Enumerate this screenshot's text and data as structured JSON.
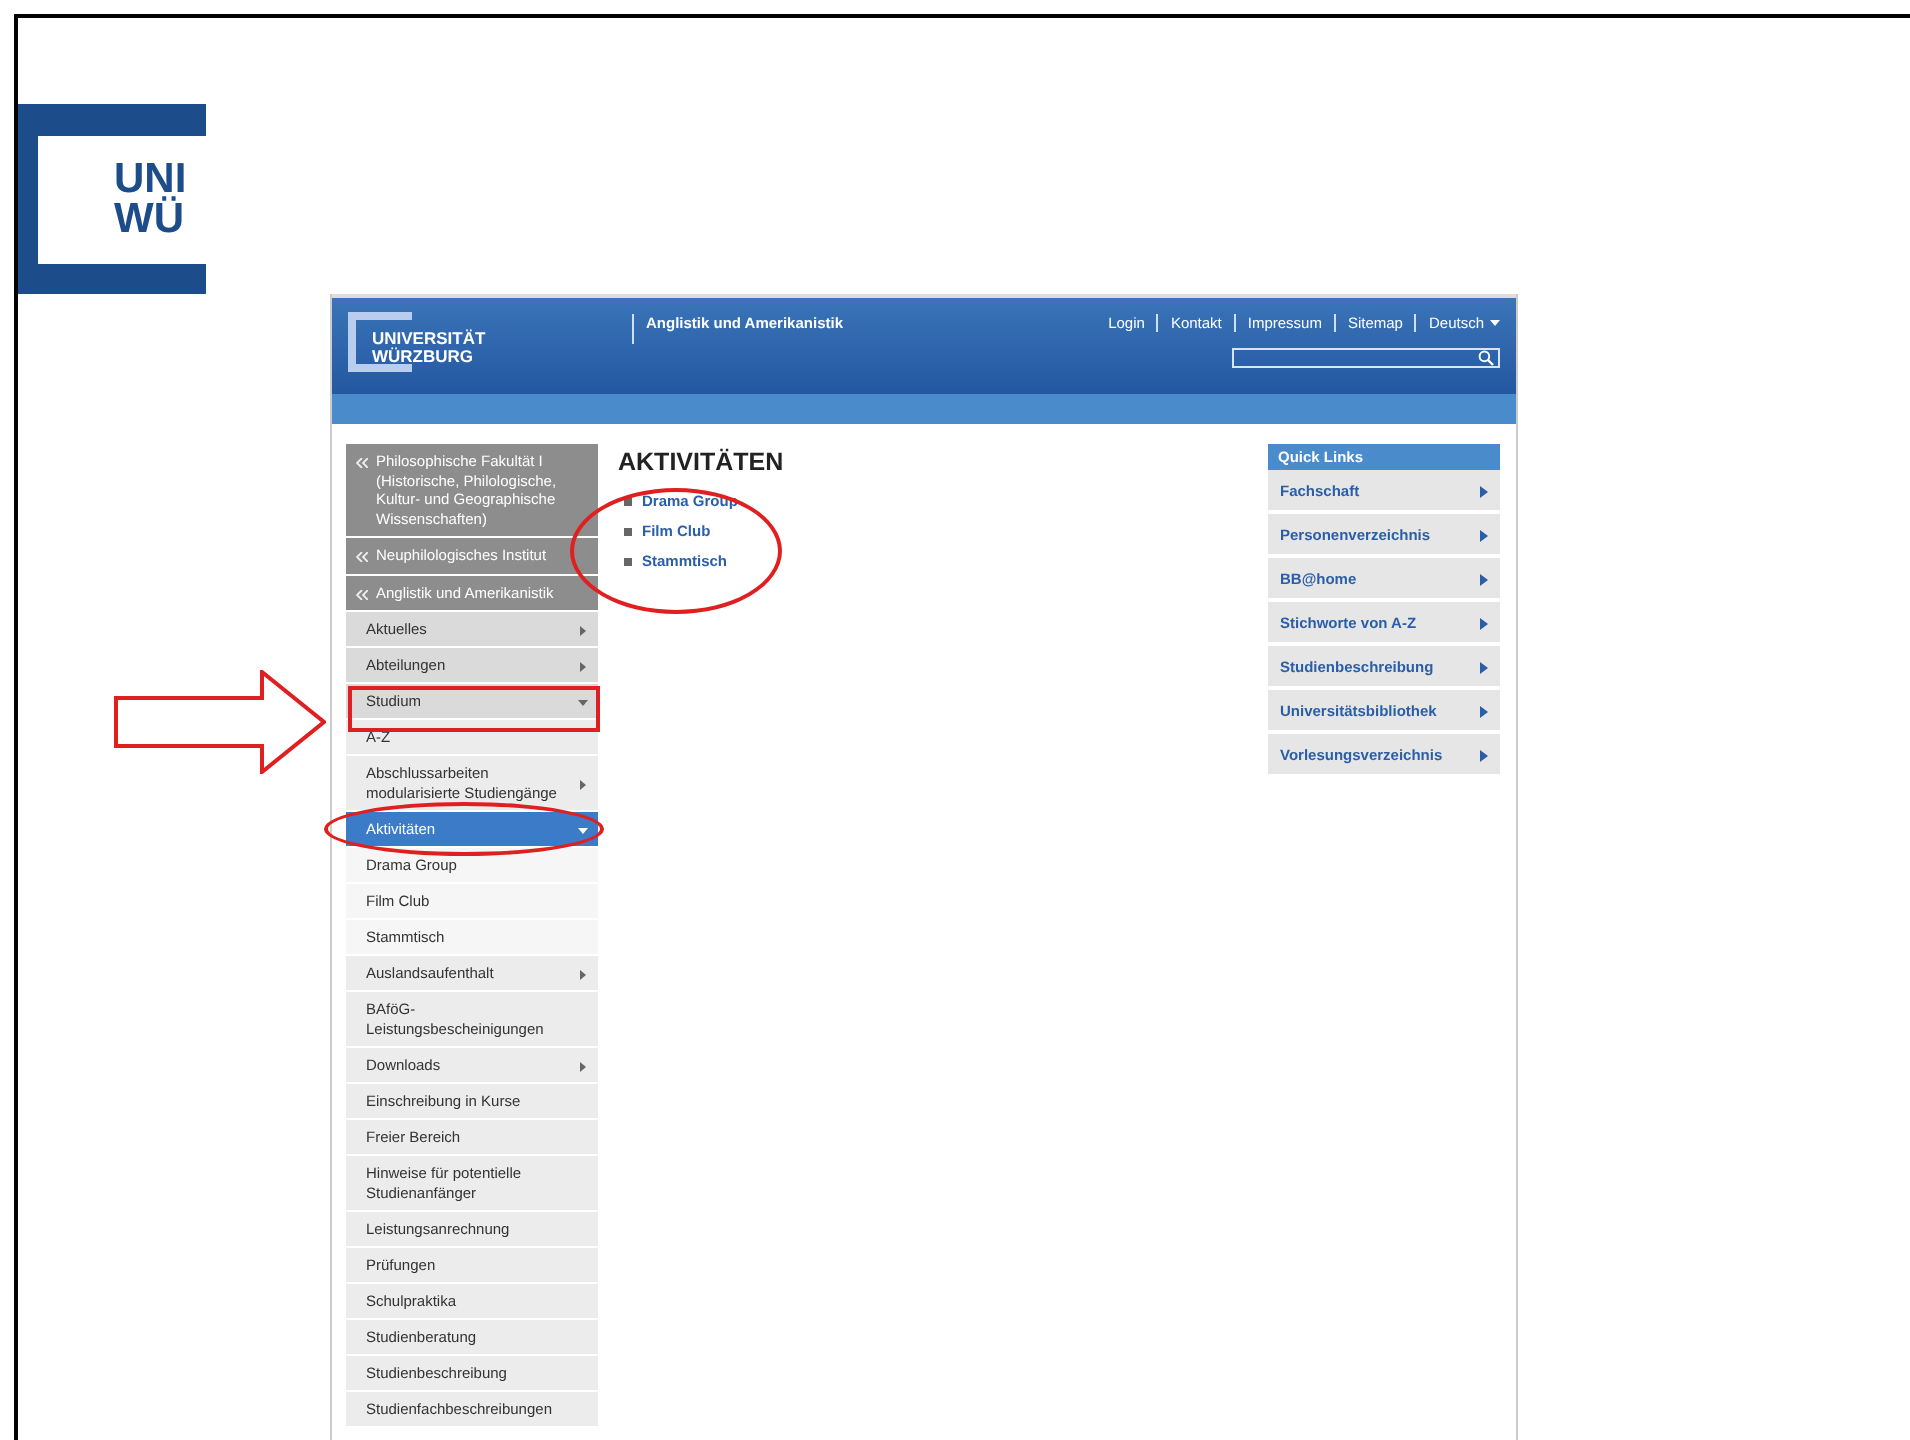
{
  "slide": {
    "logo": [
      "UNI",
      "WÜ"
    ]
  },
  "site": {
    "logo": [
      "UNIVERSITÄT",
      "WÜRZBURG"
    ],
    "title": "Anglistik und Amerikanistik",
    "nav": [
      "Login",
      "Kontakt",
      "Impressum",
      "Sitemap"
    ],
    "language": "Deutsch"
  },
  "sidebar": {
    "ancestors": [
      "Philosophische Fakultät I (Historische, Philologische, Kultur- und Geographische Wissenschaften)",
      "Neuphilologisches Institut",
      "Anglistik und Amerikanistik"
    ],
    "items": [
      {
        "label": "Aktuelles",
        "expanded": false,
        "selected": false
      },
      {
        "label": "Abteilungen",
        "expanded": false,
        "selected": false
      },
      {
        "label": "Studium",
        "expanded": true,
        "selected": false,
        "children": [
          {
            "label": "A-Z",
            "selected": false
          },
          {
            "label": "Abschlussarbeiten modularisierte Studiengänge",
            "expanded": false,
            "selected": false
          },
          {
            "label": "Aktivitäten",
            "expanded": true,
            "selected": true,
            "children": [
              {
                "label": "Drama Group",
                "selected": false
              },
              {
                "label": "Film Club",
                "selected": false
              },
              {
                "label": "Stammtisch",
                "selected": false
              }
            ]
          },
          {
            "label": "Auslandsaufenthalt",
            "expanded": false,
            "selected": false
          },
          {
            "label": "BAföG-Leistungsbescheinigungen",
            "selected": false
          },
          {
            "label": "Downloads",
            "expanded": false,
            "selected": false
          },
          {
            "label": "Einschreibung in Kurse",
            "selected": false
          },
          {
            "label": "Freier Bereich",
            "selected": false
          },
          {
            "label": "Hinweise für potentielle Studienanfänger",
            "selected": false
          },
          {
            "label": "Leistungsanrechnung",
            "selected": false
          },
          {
            "label": "Prüfungen",
            "selected": false
          },
          {
            "label": "Schulpraktika",
            "selected": false
          },
          {
            "label": "Studienberatung",
            "selected": false
          },
          {
            "label": "Studienbeschreibung",
            "selected": false
          },
          {
            "label": "Studienfachbeschreibungen",
            "selected": false
          }
        ]
      }
    ]
  },
  "content": {
    "title": "AKTIVITÄTEN",
    "links": [
      "Drama Group",
      "Film Club",
      "Stammtisch"
    ]
  },
  "quick_links": {
    "title": "Quick Links",
    "items": [
      "Fachschaft",
      "Personenverzeichnis",
      "BB@home",
      "Stichworte von A-Z",
      "Studienbeschreibung",
      "Universitätsbibliothek",
      "Vorlesungsverzeichnis"
    ]
  },
  "annotations": [
    {
      "kind": "arrow"
    },
    {
      "kind": "box"
    },
    {
      "kind": "ellipse"
    },
    {
      "kind": "ellipse"
    }
  ]
}
